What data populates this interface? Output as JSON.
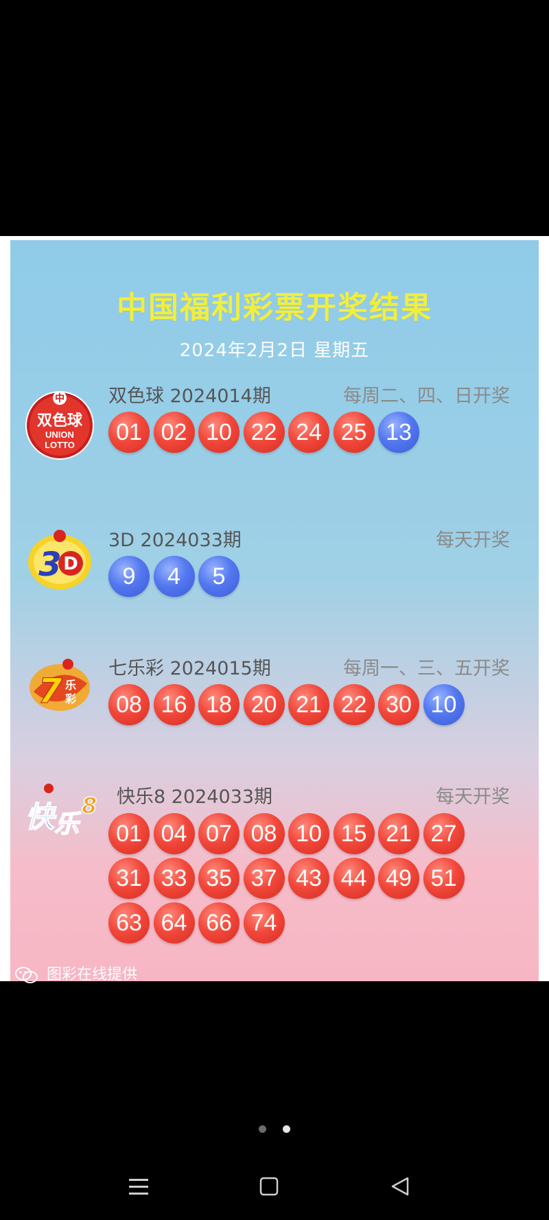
{
  "header": {
    "title": "中国福利彩票开奖结果",
    "date": "2024年2月2日  星期五"
  },
  "games": [
    {
      "id": "ssq",
      "name": "双色球 2024014期",
      "schedule": "每周二、四、日开奖",
      "logo_icon": "union-lotto-logo",
      "logo_text": "双色球 UNION LOTTO",
      "numbers": [
        {
          "value": "01",
          "color": "red"
        },
        {
          "value": "02",
          "color": "red"
        },
        {
          "value": "10",
          "color": "red"
        },
        {
          "value": "22",
          "color": "red"
        },
        {
          "value": "24",
          "color": "red"
        },
        {
          "value": "25",
          "color": "red"
        },
        {
          "value": "13",
          "color": "blue"
        }
      ]
    },
    {
      "id": "3d",
      "name": "3D 2024033期",
      "schedule": "每天开奖",
      "logo_icon": "3d-logo",
      "logo_text": "3D",
      "numbers": [
        {
          "value": "9",
          "color": "blue"
        },
        {
          "value": "4",
          "color": "blue"
        },
        {
          "value": "5",
          "color": "blue"
        }
      ]
    },
    {
      "id": "qlc",
      "name": "七乐彩 2024015期",
      "schedule": "每周一、三、五开奖",
      "logo_icon": "qilecai-logo",
      "logo_text": "7乐彩",
      "numbers": [
        {
          "value": "08",
          "color": "red"
        },
        {
          "value": "16",
          "color": "red"
        },
        {
          "value": "18",
          "color": "red"
        },
        {
          "value": "20",
          "color": "red"
        },
        {
          "value": "21",
          "color": "red"
        },
        {
          "value": "22",
          "color": "red"
        },
        {
          "value": "30",
          "color": "red"
        },
        {
          "value": "10",
          "color": "blue"
        }
      ]
    },
    {
      "id": "kl8",
      "name": "快乐8 2024033期",
      "schedule": "每天开奖",
      "logo_icon": "kuaile8-logo",
      "logo_text": "快乐8",
      "numbers": [
        {
          "value": "01",
          "color": "red"
        },
        {
          "value": "04",
          "color": "red"
        },
        {
          "value": "07",
          "color": "red"
        },
        {
          "value": "08",
          "color": "red"
        },
        {
          "value": "10",
          "color": "red"
        },
        {
          "value": "15",
          "color": "red"
        },
        {
          "value": "21",
          "color": "red"
        },
        {
          "value": "27",
          "color": "red"
        },
        {
          "value": "31",
          "color": "red"
        },
        {
          "value": "33",
          "color": "red"
        },
        {
          "value": "35",
          "color": "red"
        },
        {
          "value": "37",
          "color": "red"
        },
        {
          "value": "43",
          "color": "red"
        },
        {
          "value": "44",
          "color": "red"
        },
        {
          "value": "49",
          "color": "red"
        },
        {
          "value": "51",
          "color": "red"
        },
        {
          "value": "63",
          "color": "red"
        },
        {
          "value": "64",
          "color": "red"
        },
        {
          "value": "66",
          "color": "red"
        },
        {
          "value": "74",
          "color": "red"
        }
      ]
    }
  ],
  "footer": {
    "icon": "wechat-icon",
    "text": "图彩在线提供"
  },
  "colors": {
    "title": "#f1ee3e",
    "red_ball": "#e8423a",
    "blue_ball": "#4d6fe8"
  },
  "system": {
    "page_dots": 2,
    "active_dot": 1,
    "nav_icons": [
      "menu-icon",
      "home-square-icon",
      "back-triangle-icon"
    ]
  }
}
